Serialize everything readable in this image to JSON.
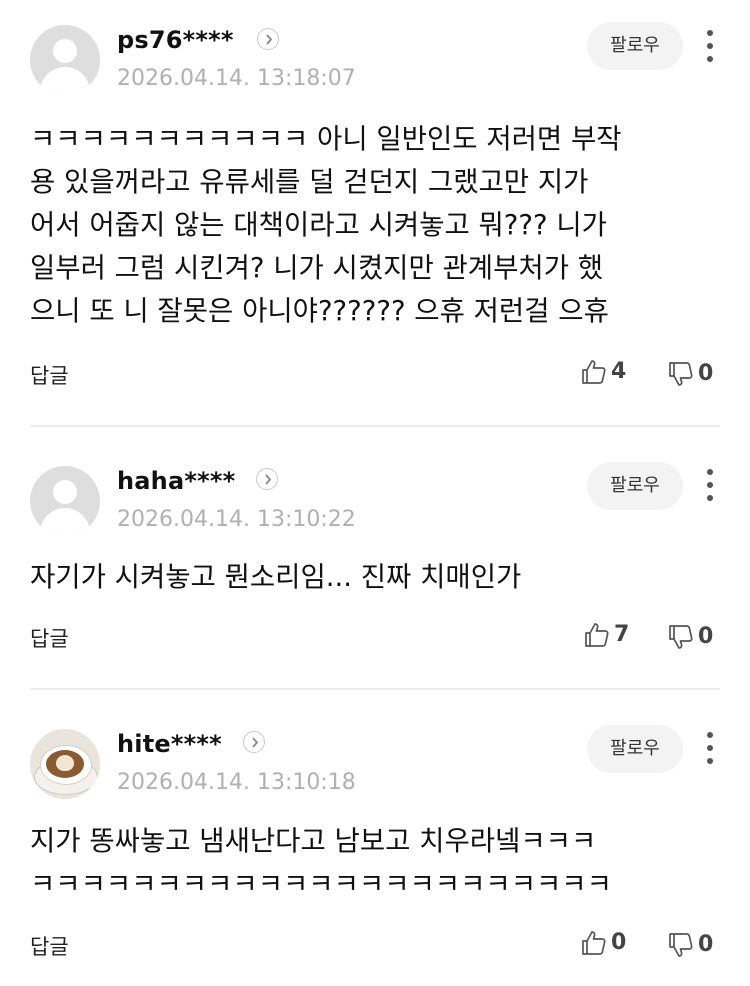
{
  "labels": {
    "follow": "팔로우",
    "reply": "답글"
  },
  "comments": [
    {
      "username": "ps76****",
      "timestamp": "2026.04.14. 13:18:07",
      "avatar": "default-avatar",
      "lines": [
        "ㅋㅋㅋㅋㅋㅋㅋㅋㅋㅋㅋ 아니 일반인도 저러면 부작",
        "용 있을꺼라고 유류세를 덜 걷던지 그랬고만 지가",
        "어서 어줍지 않는 대책이라고 시켜놓고 뭐??? 니가",
        "일부러 그럼 시킨겨? 니가 시켰지만 관계부처가 했",
        "으니 또 니 잘못은 아니야?????? 으휴 저런걸 으휴"
      ],
      "likes": "4",
      "dislikes": "0"
    },
    {
      "username": "haha****",
      "timestamp": "2026.04.14. 13:10:22",
      "avatar": "default-avatar",
      "lines": [
        "자기가 시켜놓고 뭔소리임... 진짜 치매인가"
      ],
      "likes": "7",
      "dislikes": "0"
    },
    {
      "username": "hite****",
      "timestamp": "2026.04.14. 13:10:18",
      "avatar": "latte-art-photo",
      "lines": [
        "지가 똥싸놓고 냄새난다고 남보고 치우라넼ㅋㅋㅋ",
        "ㅋㅋㅋㅋㅋㅋㅋㅋㅋㅋㅋㅋㅋㅋㅋㅋㅋㅋㅋㅋㅋㅋㅋ"
      ],
      "likes": "0",
      "dislikes": "0"
    }
  ],
  "colors": {
    "follow_bg": "#f3f3f3",
    "timestamp": "#b0b0b0",
    "divider": "#ededed"
  },
  "icons": [
    "profile-chevron-icon",
    "more-vertical-icon",
    "thumbs-up-icon",
    "thumbs-down-icon"
  ]
}
